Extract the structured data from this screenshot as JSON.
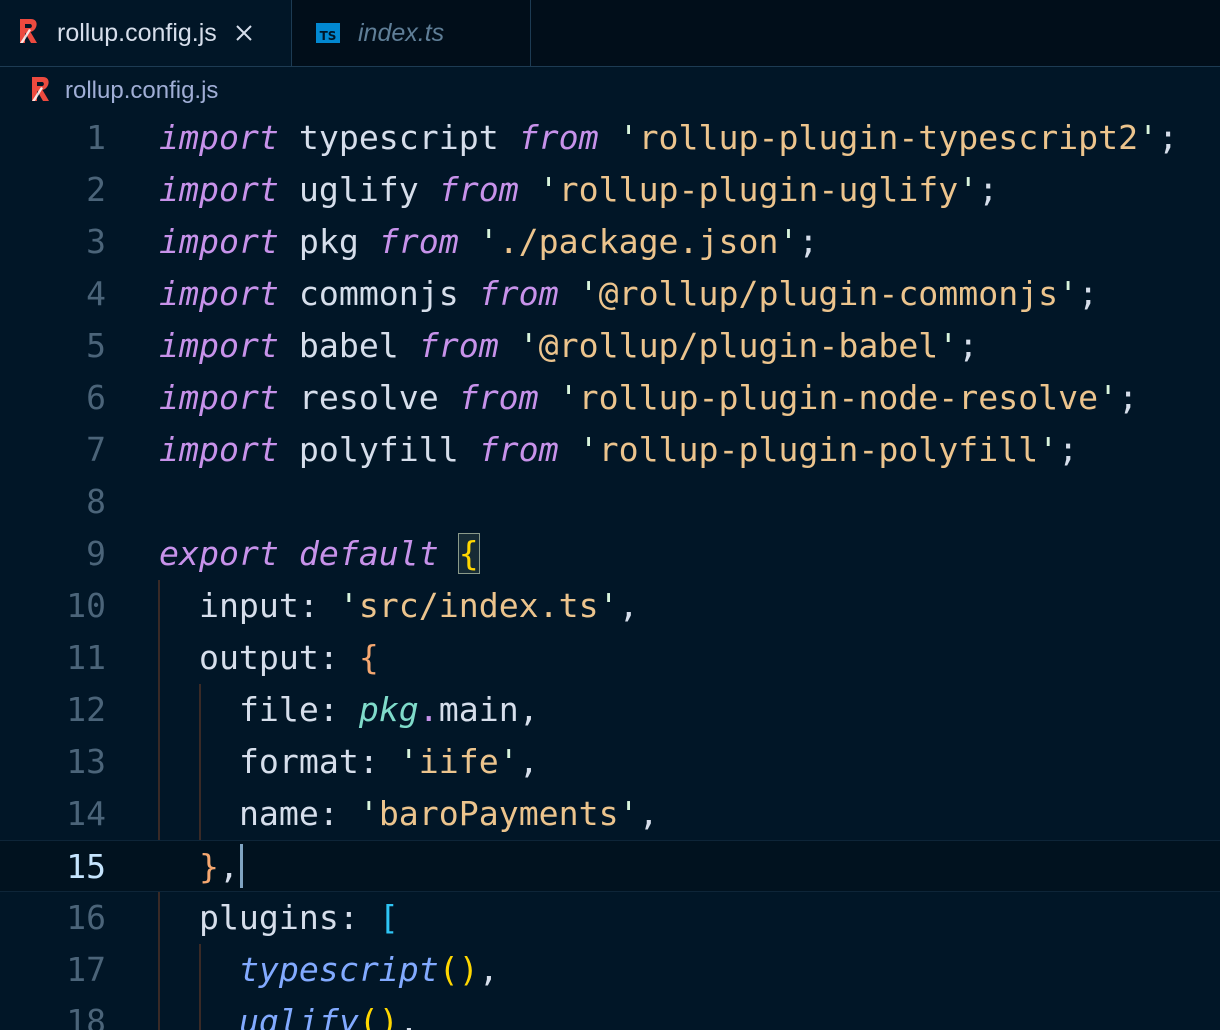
{
  "tabs": [
    {
      "label": "rollup.config.js",
      "icon": "rollup-icon",
      "active": true,
      "close_icon": "close-icon"
    },
    {
      "label": "index.ts",
      "icon": "typescript-icon",
      "icon_text": "TS",
      "active": false
    }
  ],
  "breadcrumb": {
    "icon": "rollup-icon",
    "label": "rollup.config.js"
  },
  "editor": {
    "current_line": "15",
    "line_numbers": [
      "1",
      "2",
      "3",
      "4",
      "5",
      "6",
      "7",
      "8",
      "9",
      "10",
      "11",
      "12",
      "13",
      "14",
      "15",
      "16",
      "17",
      "18"
    ],
    "lines": {
      "l1": {
        "kw1": "import",
        "id": " typescript ",
        "kw2": "from",
        "sp": " ",
        "q1": "'",
        "str": "rollup-plugin-typescript2",
        "q2": "'",
        "semi": ";"
      },
      "l2": {
        "kw1": "import",
        "id": " uglify ",
        "kw2": "from",
        "sp": " ",
        "q1": "'",
        "str": "rollup-plugin-uglify",
        "q2": "'",
        "semi": ";"
      },
      "l3": {
        "kw1": "import",
        "id": " pkg ",
        "kw2": "from",
        "sp": " ",
        "q1": "'",
        "str": "./package.json",
        "q2": "'",
        "semi": ";"
      },
      "l4": {
        "kw1": "import",
        "id": " commonjs ",
        "kw2": "from",
        "sp": " ",
        "q1": "'",
        "str": "@rollup/plugin-commonjs",
        "q2": "'",
        "semi": ";"
      },
      "l5": {
        "kw1": "import",
        "id": " babel ",
        "kw2": "from",
        "sp": " ",
        "q1": "'",
        "str": "@rollup/plugin-babel",
        "q2": "'",
        "semi": ";"
      },
      "l6": {
        "kw1": "import",
        "id": " resolve ",
        "kw2": "from",
        "sp": " ",
        "q1": "'",
        "str": "rollup-plugin-node-resolve",
        "q2": "'",
        "semi": ";"
      },
      "l7": {
        "kw1": "import",
        "id": " polyfill ",
        "kw2": "from",
        "sp": " ",
        "q1": "'",
        "str": "rollup-plugin-polyfill",
        "q2": "'",
        "semi": ";"
      },
      "l9": {
        "kw1": "export",
        "sp1": " ",
        "kw2": "default",
        "sp2": " ",
        "brace": "{"
      },
      "l10": {
        "indent": "  ",
        "key": "input",
        "colon": ": ",
        "q1": "'",
        "str": "src/index.ts",
        "q2": "'",
        "comma": ","
      },
      "l11": {
        "indent": "  ",
        "key": "output",
        "colon": ": ",
        "brace": "{"
      },
      "l12": {
        "indent": "    ",
        "key": "file",
        "colon": ": ",
        "obj": "pkg",
        "dot": ".",
        "prop": "main",
        "comma": ","
      },
      "l13": {
        "indent": "    ",
        "key": "format",
        "colon": ": ",
        "q1": "'",
        "str": "iife",
        "q2": "'",
        "comma": ","
      },
      "l14": {
        "indent": "    ",
        "key": "name",
        "colon": ": ",
        "q1": "'",
        "str": "baroPayments",
        "q2": "'",
        "comma": ","
      },
      "l15": {
        "indent": "  ",
        "brace": "}",
        "comma": ","
      },
      "l16": {
        "indent": "  ",
        "key": "plugins",
        "colon": ": ",
        "bracket": "["
      },
      "l17": {
        "indent": "    ",
        "fn": "typescript",
        "parens": "()",
        "comma": ","
      },
      "l18": {
        "indent": "    ",
        "fn": "uglify",
        "parens": "()",
        "comma": ","
      }
    }
  },
  "colors": {
    "background": "#011627",
    "keyword": "#c792ea",
    "string": "#ecc48d",
    "function": "#82aaff",
    "object": "#7fdbca",
    "rollup_icon": "#ec4a3f",
    "typescript_icon": "#0288d1"
  }
}
